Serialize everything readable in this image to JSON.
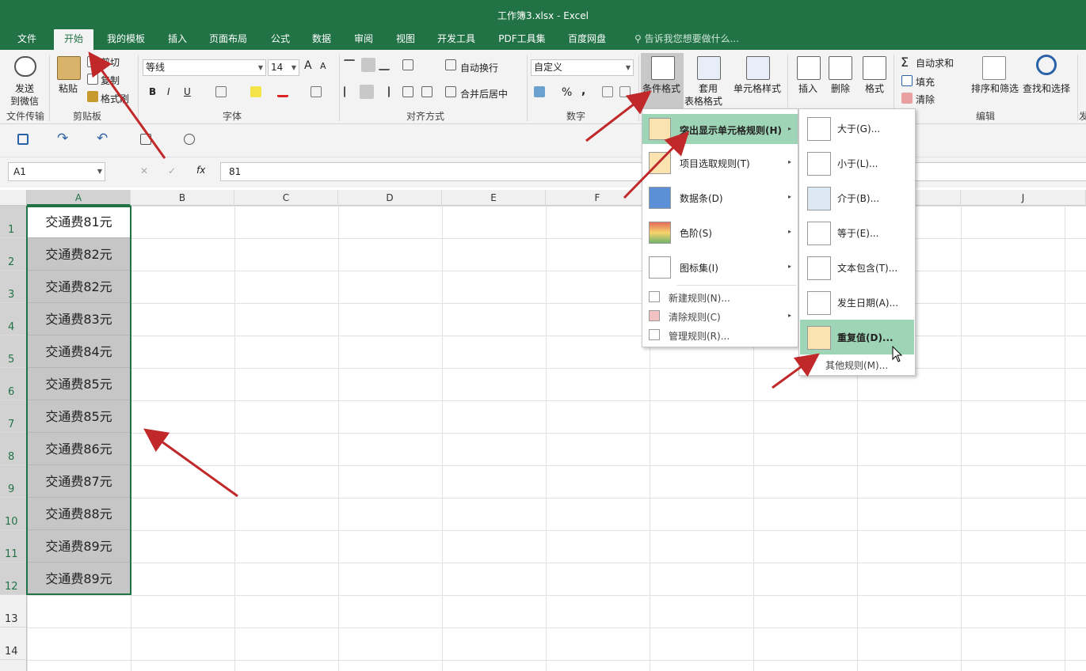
{
  "title": "工作簿3.xlsx - Excel",
  "tabs": [
    "文件",
    "开始",
    "我的模板",
    "插入",
    "页面布局",
    "公式",
    "数据",
    "审阅",
    "视图",
    "开发工具",
    "PDF工具集",
    "百度网盘"
  ],
  "tell_me": "告诉我您想要做什么...",
  "ribbon": {
    "wechat": {
      "label1": "发送",
      "label2": "到微信",
      "group": "文件传输"
    },
    "clipboard": {
      "paste": "粘贴",
      "cut": "剪切",
      "copy": "复制",
      "format_painter": "格式刷",
      "group": "剪贴板"
    },
    "font": {
      "name": "等线",
      "size": "14",
      "grow": "A",
      "shrink": "A",
      "bold": "B",
      "italic": "I",
      "underline": "U",
      "group": "字体"
    },
    "align": {
      "wrap": "自动换行",
      "merge": "合并后居中",
      "group": "对齐方式"
    },
    "number": {
      "format": "自定义",
      "percent": "%",
      "comma": ",",
      "group": "数字"
    },
    "styles": {
      "cond": "条件格式",
      "table1": "套用",
      "table2": "表格格式",
      "cell": "单元格样式"
    },
    "cells": {
      "insert": "插入",
      "delete": "删除",
      "format": "格式"
    },
    "editing": {
      "autosum": "自动求和",
      "fill": "填充",
      "clear": "清除",
      "sort": "排序和筛选",
      "find": "查找和选择",
      "group": "编辑",
      "cut_group": "发"
    }
  },
  "formula_bar": {
    "name_box": "A1",
    "fx": "fx",
    "value": "81"
  },
  "columns": [
    "A",
    "B",
    "C",
    "D",
    "E",
    "F",
    "G",
    "H",
    "I",
    "J"
  ],
  "rows": [
    "1",
    "2",
    "3",
    "4",
    "5",
    "6",
    "7",
    "8",
    "9",
    "10",
    "11",
    "12",
    "13",
    "14"
  ],
  "cells_A": [
    "交通费81元",
    "交通费82元",
    "交通费82元",
    "交通费83元",
    "交通费84元",
    "交通费85元",
    "交通费85元",
    "交通费86元",
    "交通费87元",
    "交通费88元",
    "交通费89元",
    "交通费89元"
  ],
  "menu_cond": [
    {
      "label": "突出显示单元格规则(H)",
      "arrow": "▸"
    },
    {
      "label": "项目选取规则(T)",
      "arrow": "▸"
    },
    {
      "label": "数据条(D)",
      "arrow": "▸"
    },
    {
      "label": "色阶(S)",
      "arrow": "▸"
    },
    {
      "label": "图标集(I)",
      "arrow": "▸"
    },
    {
      "label": "新建规则(N)..."
    },
    {
      "label": "清除规则(C)",
      "arrow": "▸"
    },
    {
      "label": "管理规则(R)..."
    }
  ],
  "menu_highlight": [
    {
      "label": "大于(G)...",
      "glyph": ">"
    },
    {
      "label": "小于(L)...",
      "glyph": "<"
    },
    {
      "label": "介于(B)...",
      "glyph": ""
    },
    {
      "label": "等于(E)...",
      "glyph": "="
    },
    {
      "label": "文本包含(T)...",
      "glyph": "ab"
    },
    {
      "label": "发生日期(A)...",
      "glyph": ""
    },
    {
      "label": "重复值(D)...",
      "glyph": ""
    },
    {
      "label": "其他规则(M)..."
    }
  ],
  "colors": {
    "excel_green": "#217346",
    "menu_highlight": "#9fd5b7",
    "arrow": "#c0282a"
  }
}
